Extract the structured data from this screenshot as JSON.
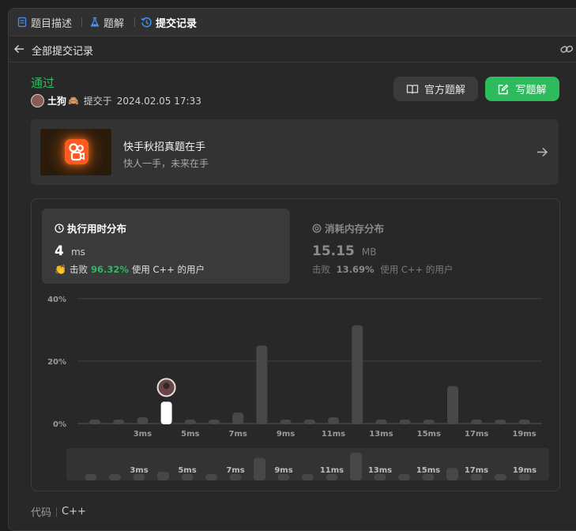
{
  "tabs": [
    {
      "label": "题目描述",
      "icon": "document-icon"
    },
    {
      "label": "题解",
      "icon": "flask-icon"
    },
    {
      "label": "提交记录",
      "icon": "history-icon"
    }
  ],
  "subheader": {
    "back_label": "全部提交记录"
  },
  "submission": {
    "status": "通过",
    "user": "土狗",
    "submitted_prefix": "提交于",
    "timestamp": "2024.02.05 17:33",
    "status_color": "#2cbb5d"
  },
  "actions": {
    "official_solution": "官方题解",
    "write_solution": "写题解",
    "accent": "#2cbb5d"
  },
  "promo": {
    "title": "快手秋招真题在手",
    "subtitle": "快人一手，未来在手"
  },
  "runtime": {
    "tab_label": "执行用时分布",
    "value": "4",
    "unit": "ms",
    "beats_label": "击败",
    "percent": "96.32%",
    "suffix": "使用 C++ 的用户"
  },
  "memory": {
    "tab_label": "消耗内存分布",
    "value": "15.15",
    "unit": "MB",
    "beats_label": "击败",
    "percent": "13.69%",
    "suffix": "使用 C++ 的用户"
  },
  "code": {
    "label": "代码",
    "language": "C++"
  },
  "chart_data": {
    "type": "bar",
    "categories": [
      "1ms",
      "2ms",
      "3ms",
      "4ms",
      "5ms",
      "6ms",
      "7ms",
      "8ms",
      "9ms",
      "10ms",
      "11ms",
      "12ms",
      "13ms",
      "14ms",
      "15ms",
      "16ms",
      "17ms",
      "18ms",
      "19ms"
    ],
    "x_tick_labels": [
      "3ms",
      "5ms",
      "7ms",
      "9ms",
      "11ms",
      "13ms",
      "15ms",
      "17ms",
      "19ms"
    ],
    "values": [
      0.5,
      0.5,
      2,
      7,
      0.5,
      0.5,
      3.5,
      25,
      0.5,
      1,
      2,
      31.5,
      0.5,
      0.5,
      0.5,
      12,
      0.5,
      0.5,
      0.5
    ],
    "highlight_category": "4ms",
    "ylim": [
      0,
      40
    ],
    "y_ticks": [
      "0%",
      "20%",
      "40%"
    ],
    "grid": true,
    "bar_color": "#484848",
    "highlight_color": "#ffffff"
  }
}
